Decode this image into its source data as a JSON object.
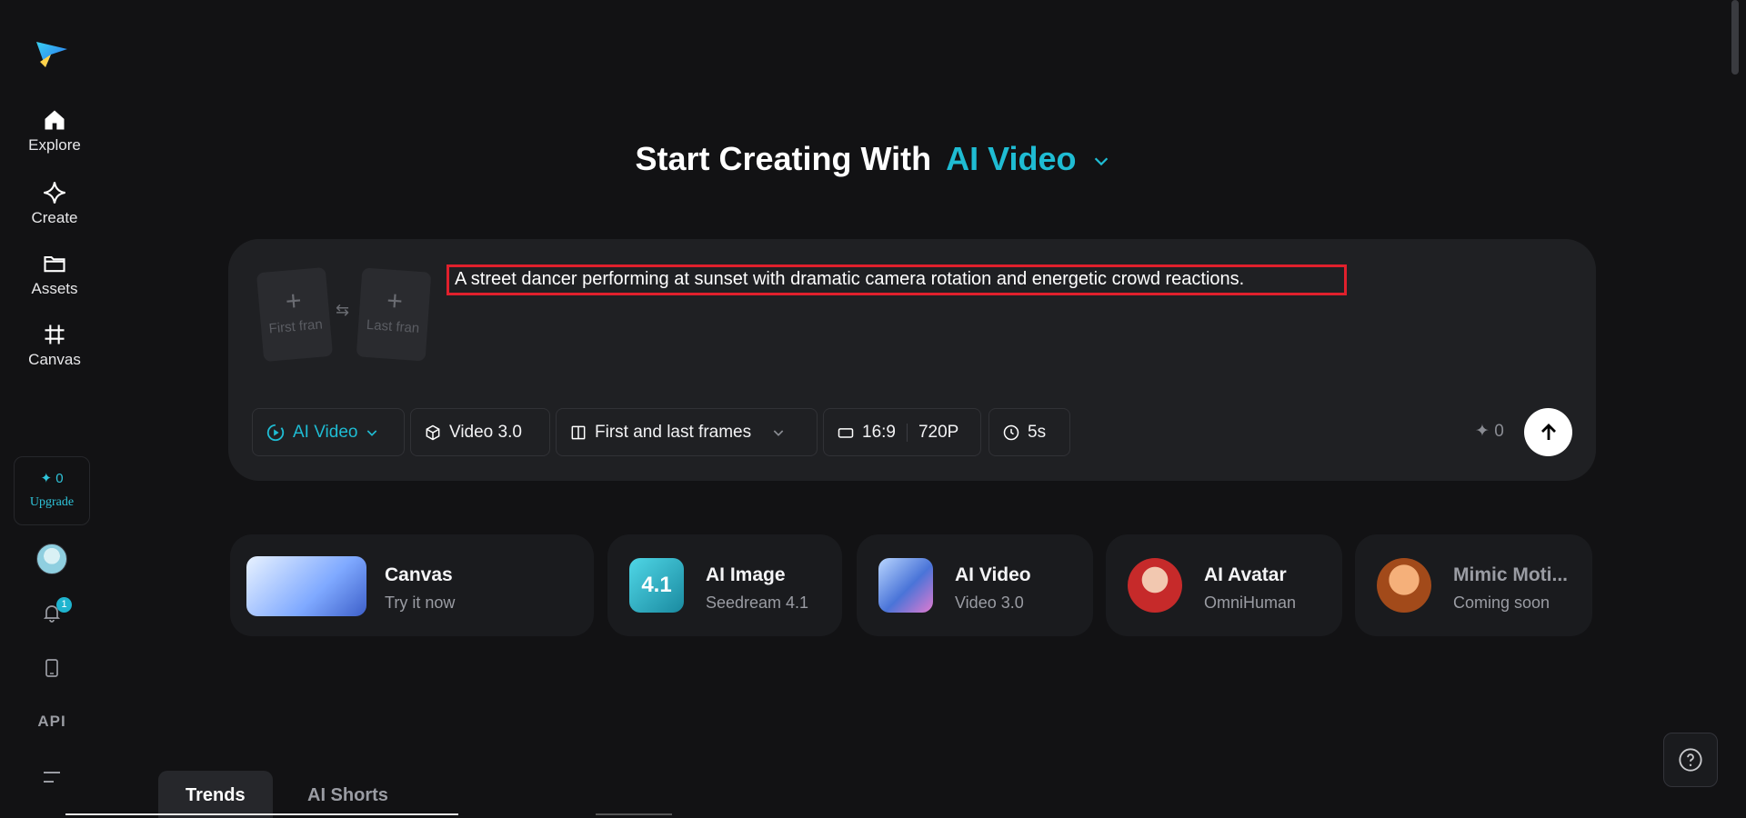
{
  "sidebar": {
    "items": [
      {
        "label": "Explore",
        "icon": "home-icon"
      },
      {
        "label": "Create",
        "icon": "sparkle-icon"
      },
      {
        "label": "Assets",
        "icon": "folder-icon"
      },
      {
        "label": "Canvas",
        "icon": "crop-icon"
      }
    ],
    "credits": "✦ 0",
    "upgrade": "Upgrade",
    "notification_count": "1",
    "api": "API"
  },
  "heading": {
    "prefix": "Start Creating With",
    "accent": "AI Video"
  },
  "prompt": {
    "first_frame": "First fran",
    "last_frame": "Last fran",
    "text": "A street dancer performing at sunset with dramatic camera rotation and energetic crowd reactions."
  },
  "toolbar": {
    "mode": "AI Video",
    "model": "Video 3.0",
    "frames": "First and last frames",
    "ratio": "16:9",
    "resolution": "720P",
    "duration": "5s",
    "credits": "✦ 0"
  },
  "cards": [
    {
      "title": "Canvas",
      "sub": "Try it now"
    },
    {
      "title": "AI Image",
      "sub": "Seedream 4.1",
      "thumb_text": "4.1"
    },
    {
      "title": "AI Video",
      "sub": "Video 3.0"
    },
    {
      "title": "AI Avatar",
      "sub": "OmniHuman"
    },
    {
      "title": "Mimic Moti...",
      "sub": "Coming soon"
    }
  ],
  "tabs": [
    {
      "label": "Trends"
    },
    {
      "label": "AI Shorts"
    }
  ],
  "colors": {
    "accent": "#1fbcd3",
    "background": "#121214",
    "panel": "#1f2023",
    "highlight": "#e0202c"
  }
}
